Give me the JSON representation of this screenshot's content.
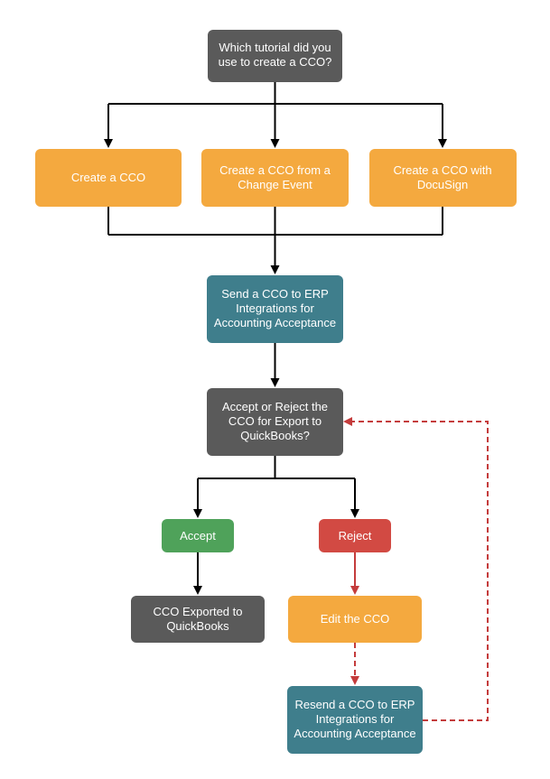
{
  "nodes": {
    "start": {
      "l1": "Which tutorial did you",
      "l2": "use to create a CCO?"
    },
    "createA": {
      "l1": "Create a CCO"
    },
    "createB": {
      "l1": "Create a CCO from a",
      "l2": "Change Event"
    },
    "createC": {
      "l1": "Create a CCO with",
      "l2": "DocuSign"
    },
    "send": {
      "l1": "Send a CCO to ERP",
      "l2": "Integrations for",
      "l3": "Accounting Acceptance"
    },
    "decision": {
      "l1": "Accept or Reject the",
      "l2": "CCO for Export to",
      "l3": "QuickBooks?"
    },
    "accept": {
      "l1": "Accept"
    },
    "reject": {
      "l1": "Reject"
    },
    "exported": {
      "l1": "CCO Exported to",
      "l2": "QuickBooks"
    },
    "edit": {
      "l1": "Edit the CCO"
    },
    "resend": {
      "l1": "Resend a CCO to ERP",
      "l2": "Integrations for",
      "l3": "Accounting Acceptance"
    }
  }
}
